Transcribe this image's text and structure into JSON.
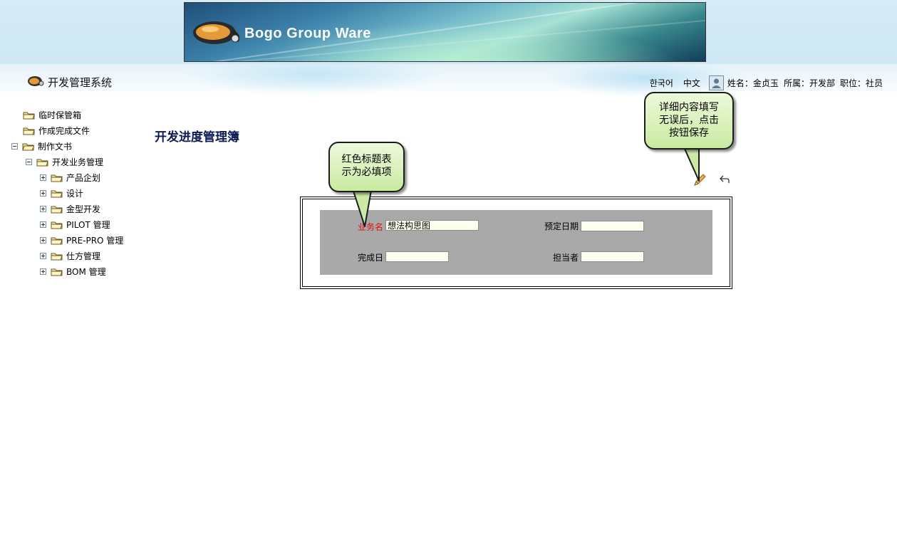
{
  "banner": {
    "title": "Bogo Group Ware"
  },
  "header": {
    "system_title": "开发管理系统",
    "lang_korean": "한국어",
    "lang_chinese": "中文",
    "name_label": "姓名：",
    "name_value": "金贞玉",
    "dept_label": "所属：",
    "dept_value": "开发部",
    "position_label": "职位：",
    "position_value": "社员"
  },
  "sidebar": {
    "items": [
      {
        "label": "临时保管箱"
      },
      {
        "label": "作成完成文件"
      },
      {
        "label": "制作文书",
        "expanded": true
      },
      {
        "label": "开发业务管理",
        "expanded": true
      },
      {
        "label": "产品企划",
        "expanded": false
      },
      {
        "label": "设计",
        "expanded": false
      },
      {
        "label": "金型开发",
        "expanded": false
      },
      {
        "label": "PILOT 管理",
        "expanded": false
      },
      {
        "label": "PRE-PRO 管理",
        "expanded": false
      },
      {
        "label": "仕方管理",
        "expanded": false
      },
      {
        "label": "BOM 管理",
        "expanded": false
      }
    ]
  },
  "main": {
    "page_title": "开发进度管理簿",
    "form": {
      "task_name_label": "业务名",
      "task_name_value": "想法构思图",
      "planned_date_label": "预定日期",
      "planned_date_value": "",
      "completion_date_label": "完成日",
      "completion_date_value": "",
      "assignee_label": "担当者",
      "assignee_value": ""
    }
  },
  "callouts": {
    "required_note_line1": "红色标题表",
    "required_note_line2": "示为必填项",
    "save_note_line1": "详细内容填写",
    "save_note_line2": "无误后，点击",
    "save_note_line3": "按钮保存"
  },
  "colors": {
    "required_label": "#e01010",
    "form_panel": "#a9a9a9",
    "page_title": "#0c1b55",
    "callout_fill": "#c9eaa0"
  }
}
